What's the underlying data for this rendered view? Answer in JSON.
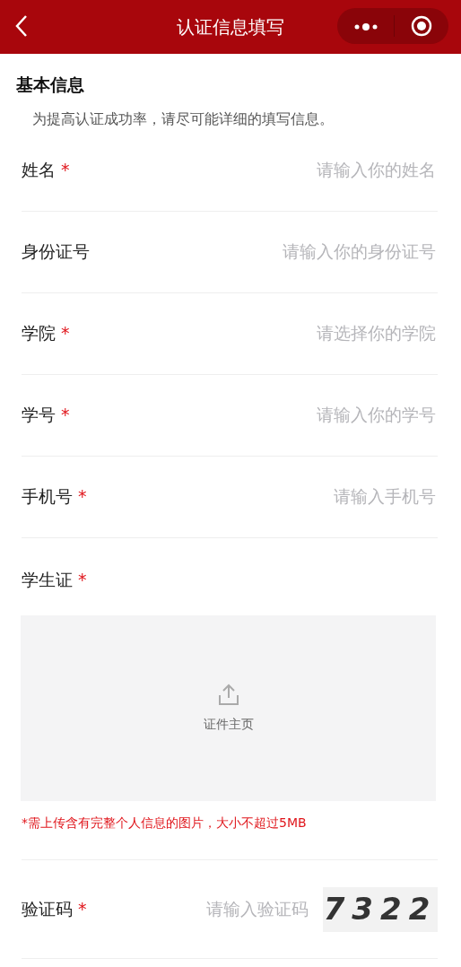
{
  "header": {
    "title": "认证信息填写"
  },
  "section": {
    "title": "基本信息",
    "hint": "为提高认证成功率，请尽可能详细的填写信息。"
  },
  "fields": [
    {
      "label": "姓名",
      "required_mark": "*",
      "placeholder": "请输入你的姓名"
    },
    {
      "label": "身份证号",
      "placeholder": "请输入你的身份证号"
    },
    {
      "label": "学院",
      "required_mark": "*",
      "placeholder": "请选择你的学院"
    },
    {
      "label": "学号",
      "required_mark": "*",
      "placeholder": "请输入你的学号"
    },
    {
      "label": "手机号",
      "required_mark": "*",
      "placeholder": "请输入手机号"
    }
  ],
  "student_card": {
    "label": "学生证",
    "required_mark": "*",
    "upload_label": "证件主页",
    "note": "*需上传含有完整个人信息的图片，大小不超过5MB"
  },
  "captcha": {
    "label": "验证码",
    "required_mark": "*",
    "placeholder": "请输入验证码",
    "code": "7322"
  }
}
